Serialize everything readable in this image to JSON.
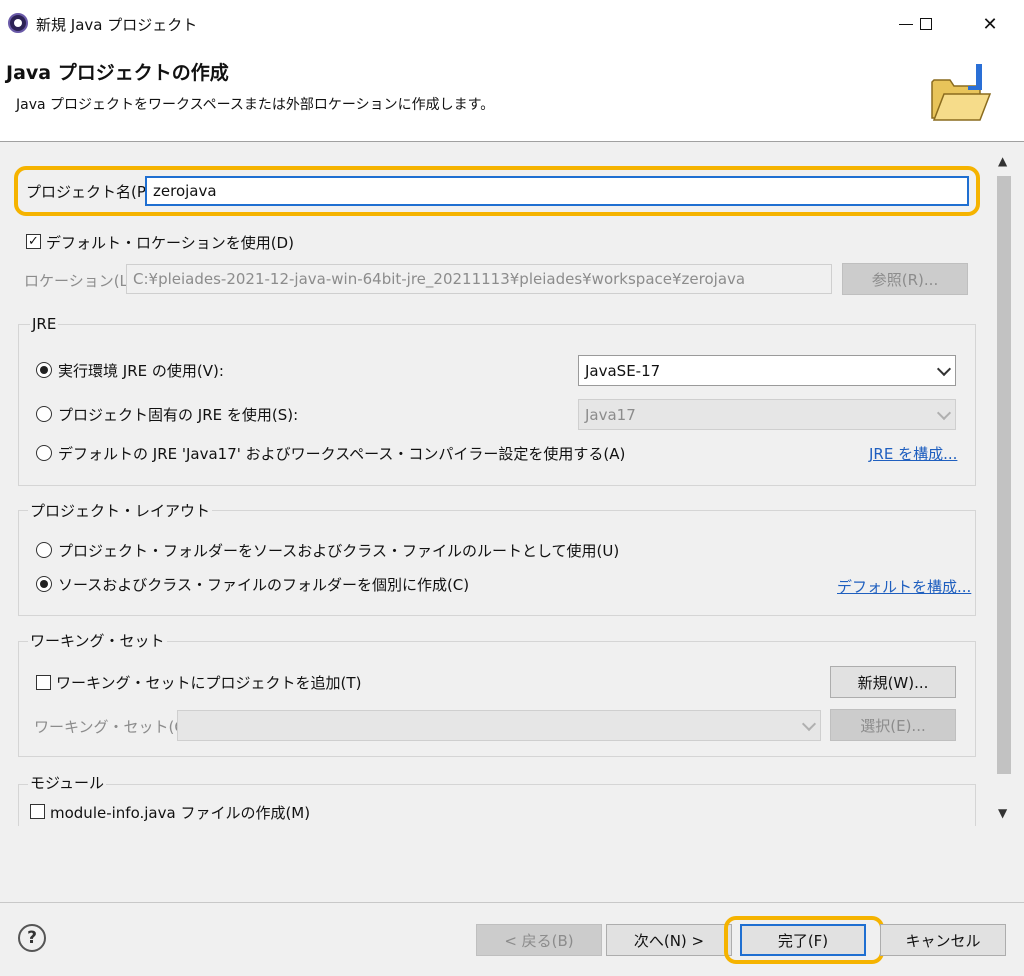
{
  "window": {
    "title": "新規 Java プロジェクト"
  },
  "header": {
    "title": "Java プロジェクトの作成",
    "description": "Java プロジェクトをワークスペースまたは外部ロケーションに作成します。"
  },
  "project": {
    "name_label": "プロジェクト名(P):",
    "name_value": "zerojava",
    "default_location_label": "デフォルト・ロケーションを使用(D)",
    "default_location_checked": true,
    "location_label": "ロケーション(L):",
    "location_value": "C:¥pleiades-2021-12-java-win-64bit-jre_20211113¥pleiades¥workspace¥zerojava",
    "browse_label": "参照(R)..."
  },
  "jre": {
    "title": "JRE",
    "option_env_label": "実行環境 JRE の使用(V):",
    "option_env_value": "JavaSE-17",
    "option_project_label": "プロジェクト固有の JRE を使用(S):",
    "option_project_value": "Java17",
    "option_default_label": "デフォルトの JRE 'Java17' およびワークスペース・コンパイラー設定を使用する(A)",
    "configure_link": "JRE を構成...",
    "selected": "env"
  },
  "layout": {
    "title": "プロジェクト・レイアウト",
    "option_root_label": "プロジェクト・フォルダーをソースおよびクラス・ファイルのルートとして使用(U)",
    "option_separate_label": "ソースおよびクラス・ファイルのフォルダーを個別に作成(C)",
    "configure_link": "デフォルトを構成...",
    "selected": "separate"
  },
  "working_set": {
    "title": "ワーキング・セット",
    "add_label": "ワーキング・セットにプロジェクトを追加(T)",
    "new_button": "新規(W)...",
    "select_label": "ワーキング・セット(O):",
    "select_button": "選択(E)..."
  },
  "module": {
    "title": "モジュール",
    "create_label": "module-info.java ファイルの作成(M)"
  },
  "footer": {
    "back_button": "< 戻る(B)",
    "next_button": "次へ(N) >",
    "finish_button": "完了(F)",
    "cancel_button": "キャンセル"
  },
  "colors": {
    "highlight": "#f5b300",
    "focus": "#1f6fd1",
    "link": "#1f5fbf"
  }
}
